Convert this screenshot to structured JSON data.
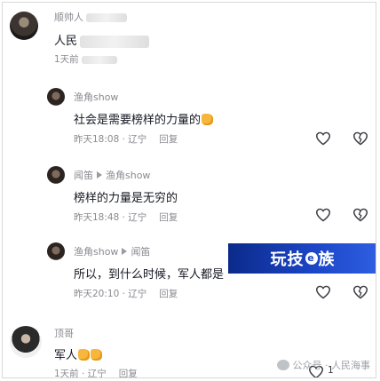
{
  "comments": [
    {
      "author": "顺帅人",
      "text": "人民",
      "meta_time": "1天前",
      "meta_loc": "",
      "reply_label": ""
    },
    {
      "author": "渔角show",
      "text": "社会是需要榜样的力量的",
      "meta_time": "昨天18:08",
      "meta_loc": "辽宁",
      "reply_label": "回复",
      "emoji": "thumbs-up"
    },
    {
      "author": "闻笛",
      "reply_to": "渔角show",
      "text": "榜样的力量是无穷的",
      "meta_time": "昨天18:48",
      "meta_loc": "辽宁",
      "reply_label": "回复"
    },
    {
      "author": "渔角show",
      "reply_to": "闻笛",
      "text": "所以，到什么时候，军人都是",
      "meta_time": "昨天20:10",
      "meta_loc": "辽宁",
      "reply_label": "回复"
    },
    {
      "author": "顶哥",
      "text": "军人",
      "meta_time": "1天前",
      "meta_loc": "辽宁",
      "reply_label": "回复",
      "like_count": "1"
    }
  ],
  "brand": {
    "part1": "玩技",
    "e": "e",
    "part2": "族"
  },
  "watermark": {
    "text": "公众号 · 人民海事"
  },
  "colors": {
    "brand_bg": "#1c47c9",
    "meta_gray": "#8a8b91",
    "emoji": "#f6b73c"
  }
}
